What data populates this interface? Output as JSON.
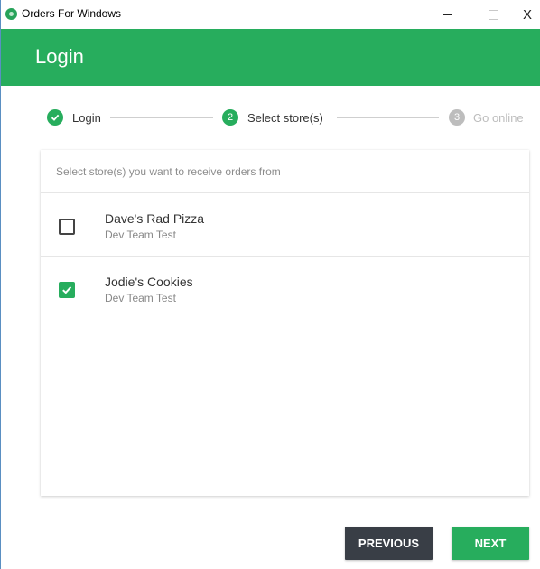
{
  "window": {
    "title": "Orders For Windows",
    "controls": {
      "minimize": "–",
      "maximize": "□",
      "close": "X"
    }
  },
  "header": {
    "title": "Login"
  },
  "stepper": {
    "steps": [
      {
        "number": "1",
        "label": "Login",
        "state": "done"
      },
      {
        "number": "2",
        "label": "Select store(s)",
        "state": "active"
      },
      {
        "number": "3",
        "label": "Go online",
        "state": "todo"
      }
    ]
  },
  "card": {
    "hint": "Select store(s) you want to receive orders from",
    "stores": [
      {
        "name": "Dave's Rad Pizza",
        "team": "Dev Team Test",
        "checked": false
      },
      {
        "name": "Jodie's Cookies",
        "team": "Dev Team Test",
        "checked": true
      }
    ]
  },
  "buttons": {
    "previous": "PREVIOUS",
    "next": "NEXT"
  },
  "colors": {
    "accent": "#27ad5d",
    "dark_button": "#393e46",
    "inactive_step": "#bdbdbd"
  }
}
